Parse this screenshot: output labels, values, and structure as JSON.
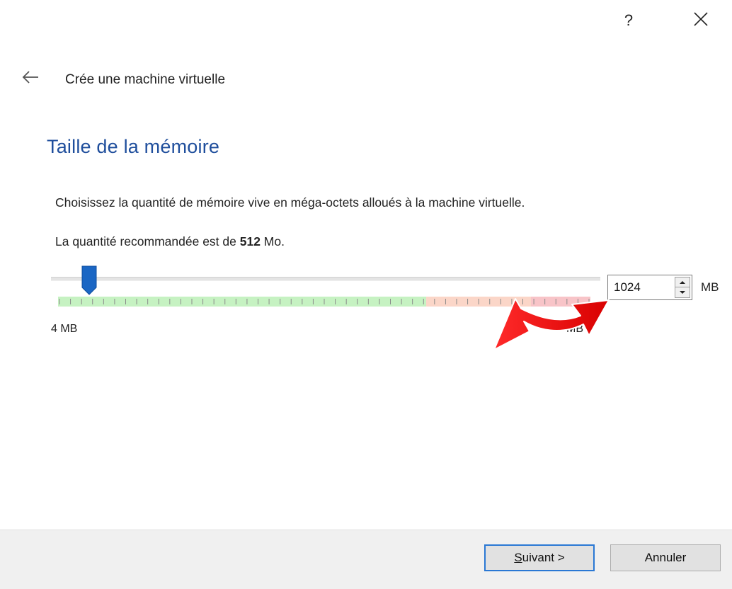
{
  "titlebar": {
    "help_label": "?"
  },
  "header": {
    "title": "Crée une machine virtuelle"
  },
  "page": {
    "heading": "Taille de la mémoire",
    "description": "Choisissez la quantité de mémoire vive en méga-octets alloués à la machine virtuelle.",
    "recommended_prefix": "La quantité recommandée est de ",
    "recommended_value": "512",
    "recommended_suffix": " Mo."
  },
  "memory_slider": {
    "min_label": "4 MB",
    "max_label": "MB",
    "position_fraction": 0.07,
    "zones": [
      "green",
      "orange",
      "red"
    ]
  },
  "memory_input": {
    "value": "1024",
    "unit": "MB"
  },
  "footer": {
    "next_mnemonic": "S",
    "next_rest": "uivant >",
    "cancel_label": "Annuler"
  },
  "colors": {
    "heading": "#1f4e9c",
    "slider_handle": "#1a66c4",
    "zone_green": "#c6f2c2",
    "zone_orange": "#fbd6c8",
    "zone_red": "#f8c4c8",
    "focus_border": "#2a78d4",
    "annotation_arrow": "#ee1010"
  }
}
